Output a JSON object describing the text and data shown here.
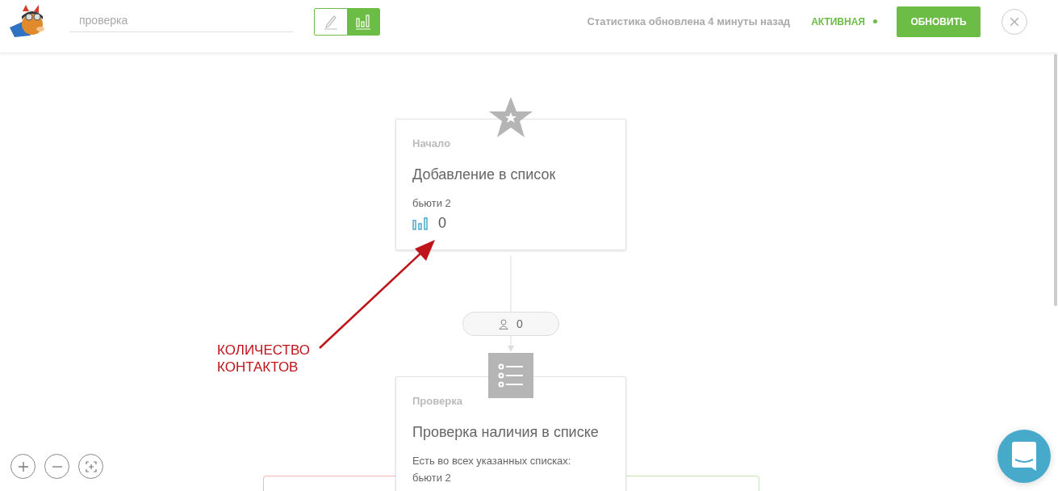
{
  "header": {
    "title_field": {
      "value": "проверка"
    },
    "mode_tabs": [
      {
        "kind": "edit",
        "selected": false
      },
      {
        "kind": "stats",
        "selected": true
      }
    ],
    "stats_note": "Статистика обновлена 4 минуты назад",
    "status": {
      "label": "АКТИВНАЯ",
      "active": true
    },
    "refresh_button": "ОБНОВИТЬ"
  },
  "nodes": [
    {
      "kind": "start",
      "type_label": "Начало",
      "title": "Добавление в список",
      "detail": "бьюти 2",
      "count": "0"
    },
    {
      "kind": "check",
      "type_label": "Проверка",
      "title": "Проверка наличия в списке",
      "detail": "Есть во всех указанных списках: бьюти 2"
    }
  ],
  "link_counter": "0",
  "annotation": "КОЛИЧЕСТВО\nКОНТАКТОВ"
}
